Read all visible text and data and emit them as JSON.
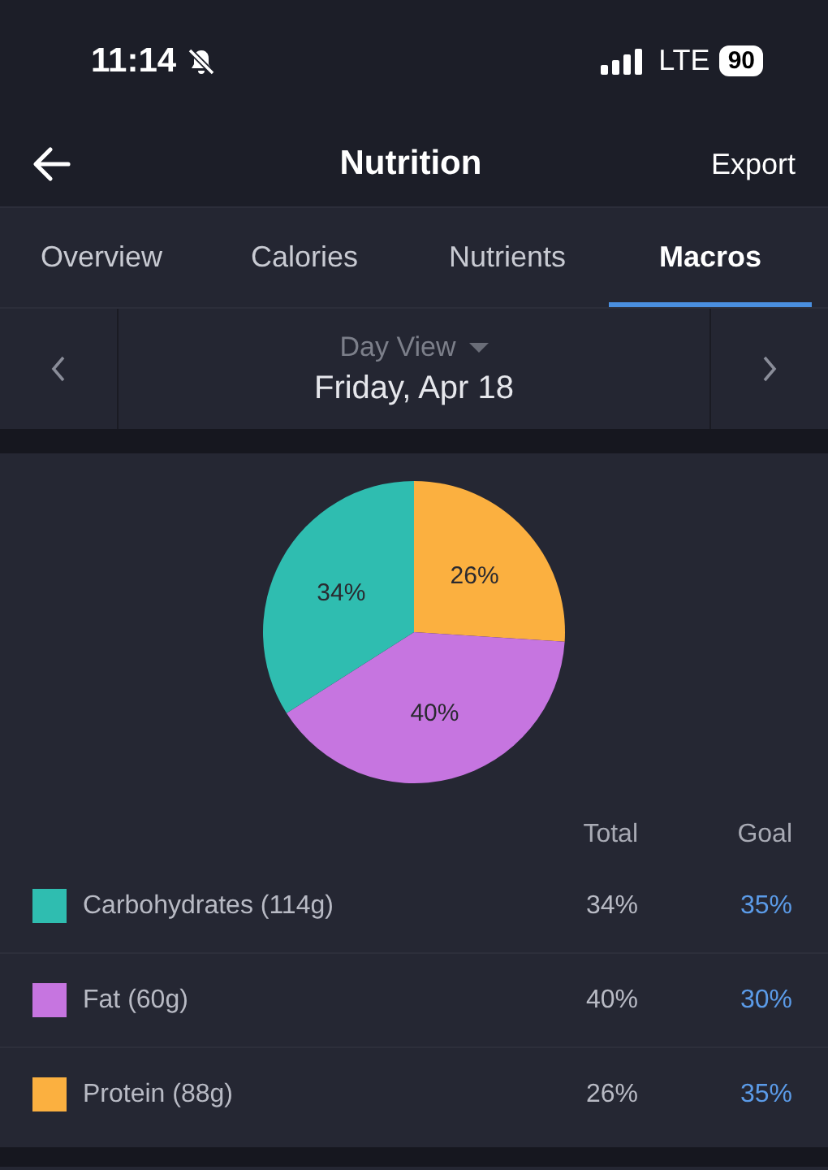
{
  "status_bar": {
    "time": "11:14",
    "network": "LTE",
    "battery": "90"
  },
  "header": {
    "title": "Nutrition",
    "action": "Export"
  },
  "tabs": [
    {
      "label": "Overview",
      "selected": false
    },
    {
      "label": "Calories",
      "selected": false
    },
    {
      "label": "Nutrients",
      "selected": false
    },
    {
      "label": "Macros",
      "selected": true
    }
  ],
  "date_nav": {
    "view": "Day View",
    "date": "Friday, Apr 18"
  },
  "macros": {
    "chart_data": {
      "type": "pie",
      "values": [
        34,
        40,
        26
      ],
      "value_labels": [
        "34%",
        "40%",
        "26%"
      ]
    },
    "columns": [
      "Total",
      "Goal"
    ],
    "rows": [
      {
        "name": "Carbohydrates (114g)",
        "color": "#2fbdb0",
        "total": "34%",
        "goal": "35%"
      },
      {
        "name": "Fat (60g)",
        "color": "#c675e0",
        "total": "40%",
        "goal": "30%"
      },
      {
        "name": "Protein (88g)",
        "color": "#fbb040",
        "total": "26%",
        "goal": "35%"
      }
    ]
  }
}
